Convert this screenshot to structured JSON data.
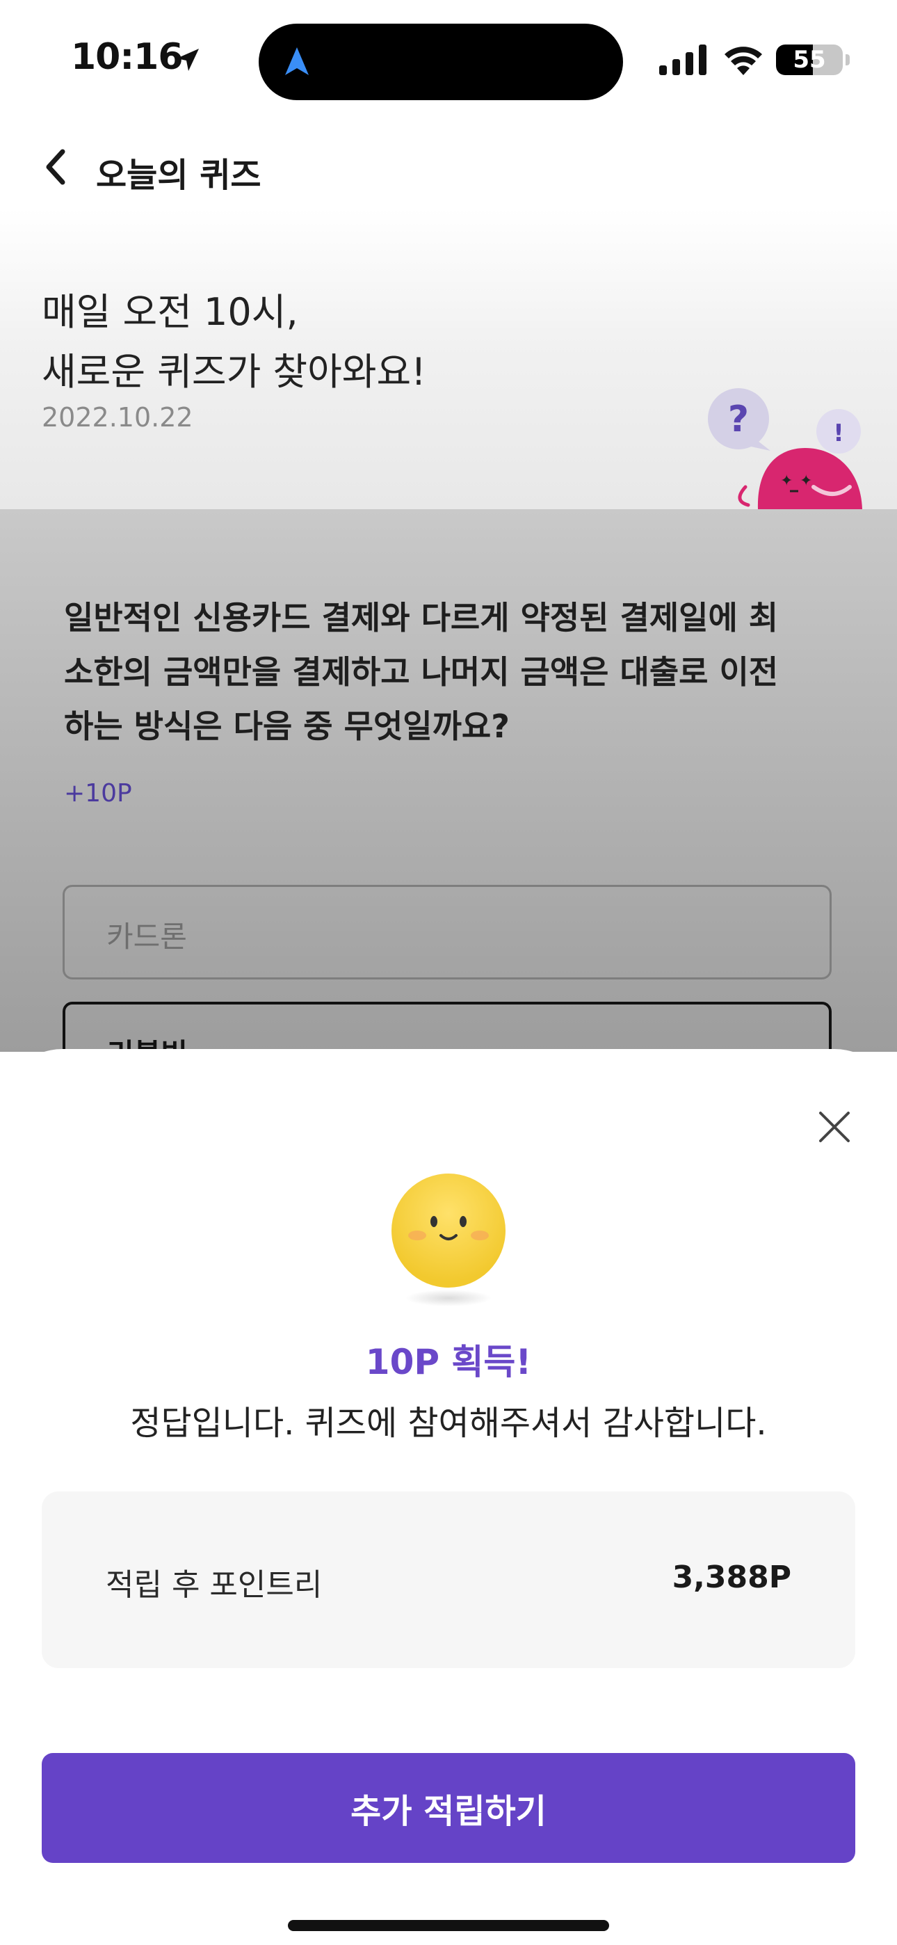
{
  "status_bar": {
    "time": "10:16",
    "battery": "55",
    "battery_level": 0.55
  },
  "header": {
    "title": "오늘의 퀴즈"
  },
  "hero": {
    "line1": "매일 오전 10시,",
    "line2": "새로운 퀴즈가 찾아와요!",
    "date": "2022.10.22"
  },
  "question": {
    "line1": "일반적인 신용카드 결제와 다르게 약정된 결제일에 최",
    "line2": "소한의 금액만을 결제하고 나머지 금액은 대출로 이전",
    "line3": "하는 방식은 다음 중 무엇일까요?",
    "points": "+10P",
    "options": [
      {
        "label": "카드론"
      },
      {
        "label": "리볼빙"
      }
    ]
  },
  "result_sheet": {
    "title": "10P 획득!",
    "message": "정답입니다. 퀴즈에 참여해주셔서 감사합니다.",
    "points_label": "적립 후 포인트리",
    "points_value": "3,388P",
    "cta_label": "추가 적립하기"
  },
  "colors": {
    "accent": "#6543c7",
    "accent_text": "#6a48c9",
    "mascot": "#d8266f"
  },
  "icons": [
    "location-arrow-icon",
    "navigation-icon",
    "signal-icon",
    "wifi-icon",
    "battery-icon",
    "back-chevron-icon",
    "close-icon",
    "smiley-icon",
    "mascot-icon"
  ]
}
